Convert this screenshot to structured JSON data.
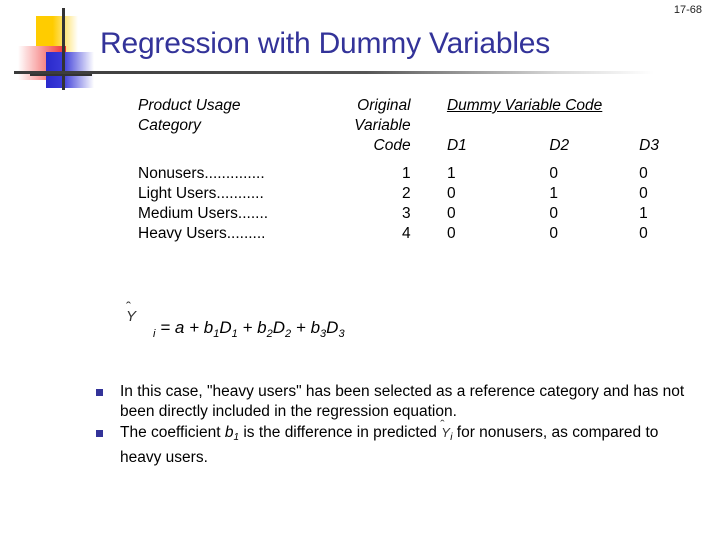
{
  "slide": {
    "number": "17-68",
    "title": "Regression with Dummy Variables"
  },
  "table": {
    "headers": {
      "category_line1": "Product Usage",
      "category_line2": "Category",
      "original_line1": "Original",
      "original_line2": "Variable",
      "original_line3": "Code",
      "dummy_group": "Dummy Variable Code",
      "d1": "D1",
      "d2": "D2",
      "d3": "D3"
    },
    "rows": [
      {
        "category": "Nonusers..............",
        "original": "1",
        "d1": "1",
        "d2": "0",
        "d3": "0"
      },
      {
        "category": "Light Users...........",
        "original": "2",
        "d1": "0",
        "d2": "1",
        "d3": "0"
      },
      {
        "category": "Medium Users.......",
        "original": "3",
        "d1": "0",
        "d2": "0",
        "d3": "1"
      },
      {
        "category": "Heavy Users.........",
        "original": "4",
        "d1": "0",
        "d2": "0",
        "d3": "0"
      }
    ]
  },
  "equation": {
    "lhs_symbol": "Y",
    "lhs_hat": "ˆ",
    "lhs_subscript": "i",
    "rhs": "= a + b1D1 + b2D2 + b3D3",
    "parts": {
      "eq": "=",
      "a": "a",
      "plus": "+",
      "b": "b",
      "D": "D",
      "s1": "1",
      "s2": "2",
      "s3": "3"
    }
  },
  "bullets": [
    {
      "text_before": "In this case, \"heavy users\" has been selected as a reference category and has not been directly included in the regression equation.",
      "has_symbol": false
    },
    {
      "text_before": "The coefficient ",
      "italic_term": "b",
      "italic_sub": "1",
      "text_middle": " is the difference in predicted ",
      "symbol": "Y",
      "symbol_hat": "ˆ",
      "symbol_sub": "i",
      "text_after": " for nonusers, as compared to heavy users.",
      "has_symbol": true
    }
  ],
  "colors": {
    "title": "#333399",
    "bullet": "#333399",
    "logo_yellow": "#FFCC00",
    "logo_red": "#F03030",
    "logo_blue": "#2A2ACC",
    "rule": "#3a3a3a",
    "text": "#000000"
  }
}
